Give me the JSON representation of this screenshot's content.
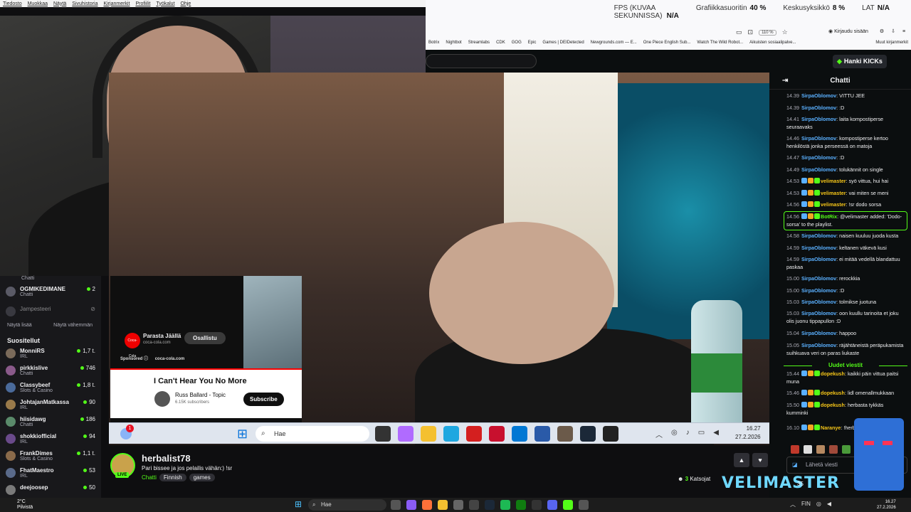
{
  "menubar": [
    "Tiedosto",
    "Muokkaa",
    "Näytä",
    "Sivuhistoria",
    "Kirjanmerkit",
    "Profiilit",
    "Työkalut",
    "Ohje"
  ],
  "perf": {
    "fps_label": "FPS (KUVAA SEKUNNISSA)",
    "fps_value": "N/A",
    "gpu_label": "Grafiikkasuoritin",
    "gpu_value": "40 %",
    "ram_label": "Keskusyksikkö",
    "ram_value": "8 %",
    "lat_label": "LAT",
    "lat_value": "N/A"
  },
  "browser": {
    "zoom": "110 %",
    "login": "Kirjaudu sisään",
    "other_bookmarks": "Muut kirjanmerkit"
  },
  "bookmarks": [
    "Botrix",
    "Nightbot",
    "Streamlabs",
    "CDK",
    "GOG",
    "Epic",
    "Games | DEIDetected",
    "Newgrounds.com — E...",
    "One Piece English Sub...",
    "Watch The Wild Robot...",
    "Aikuisten sosiaalipalve..."
  ],
  "kick": {
    "get_kicks": "Hanki KICKs"
  },
  "sidebar": {
    "top_items": [
      {
        "name": "OGMIKEDIMANE",
        "category": "Chatti",
        "viewers": "2"
      },
      {
        "name": "Jampesteeri",
        "category": "",
        "viewers": ""
      }
    ],
    "show_more": "Näytä lisää",
    "show_less": "Näytä vähemmän",
    "recommended_header": "Suositellut",
    "recommended": [
      {
        "name": "MonniRS",
        "category": "IRL",
        "viewers": "1,7 t."
      },
      {
        "name": "pirkkislive",
        "category": "Chatti",
        "viewers": "746"
      },
      {
        "name": "Classybeef",
        "category": "Slots & Casino",
        "viewers": "1,8 t."
      },
      {
        "name": "JohtajanMatkassa",
        "category": "IRL",
        "viewers": "90"
      },
      {
        "name": "hiisidawg",
        "category": "Chatti",
        "viewers": "186"
      },
      {
        "name": "shokkiofficial",
        "category": "IRL",
        "viewers": "94"
      },
      {
        "name": "FrankDimes",
        "category": "Slots & Casino",
        "viewers": "1,1 t."
      },
      {
        "name": "FhatMaestro",
        "category": "IRL",
        "viewers": "53"
      },
      {
        "name": "deejoosep",
        "category": "",
        "viewers": "50"
      }
    ],
    "first_cat": "Chatti"
  },
  "youtube": {
    "ad_name": "Parasta Jäällä",
    "ad_domain": "coca-cola.com",
    "ad_logo": "Coca-Cola",
    "visit_button": "Osallistu",
    "sponsored": "Sponsored",
    "sponsored_domain": "coca-cola.com",
    "title": "I Can't Hear You No More",
    "channel": "Russ Ballard - Topic",
    "subs": "6.15K subscribers",
    "subscribe": "Subscribe"
  },
  "stream_taskbar": {
    "badge": "1",
    "search": "Hae",
    "time": "16.27",
    "date": "27.2.2026"
  },
  "channel": {
    "name": "herbalist78",
    "live": "LIVE",
    "title": "Pari bissee ja jos pelailis vähän:) !sr",
    "category": "Chatti",
    "tags": [
      "Finnish",
      "games"
    ],
    "viewers_count": "3",
    "viewers_label": "Katsojat"
  },
  "chat": {
    "title": "Chatti",
    "messages": [
      {
        "t": "14.39",
        "u": "SirpaOblomov",
        "c": "#5ab0ff",
        "m": "VITTU JEE"
      },
      {
        "t": "14.39",
        "u": "SirpaOblomov",
        "c": "#5ab0ff",
        "m": ":D"
      },
      {
        "t": "14.41",
        "u": "SirpaOblomov",
        "c": "#5ab0ff",
        "m": "laita kompostiperse seuraavaks"
      },
      {
        "t": "14.46",
        "u": "SirpaOblomov",
        "c": "#5ab0ff",
        "m": "kompostiperse kertoo henkilöstä jonka perseessä on matoja"
      },
      {
        "t": "14.47",
        "u": "SirpaOblomov",
        "c": "#5ab0ff",
        "m": ":D"
      },
      {
        "t": "14.49",
        "u": "SirpaOblomov",
        "c": "#5ab0ff",
        "m": "tolukännit on single"
      },
      {
        "t": "14.53",
        "u": "velimaster",
        "c": "#f5c518",
        "m": "syö vittua, hui hai"
      },
      {
        "t": "14.53",
        "u": "velimaster",
        "c": "#f5c518",
        "m": "vai miten se meni"
      },
      {
        "t": "14.56",
        "u": "velimaster",
        "c": "#f5c518",
        "m": "!sr dodo sorsa"
      },
      {
        "t": "14.56",
        "u": "BotRix",
        "c": "#53fc18",
        "m": "@velimaster added: 'Dodo-sorsa' to the playlist."
      },
      {
        "t": "14.58",
        "u": "SirpaOblomov",
        "c": "#5ab0ff",
        "m": "naisen kuuluu juoda kusta"
      },
      {
        "t": "14.59",
        "u": "SirpaOblomov",
        "c": "#5ab0ff",
        "m": "keltanen väkevä kusi"
      },
      {
        "t": "14.59",
        "u": "SirpaOblomov",
        "c": "#5ab0ff",
        "m": "ei mitää vedellä blandattuu paskaa"
      },
      {
        "t": "15.00",
        "u": "SirpaOblomov",
        "c": "#5ab0ff",
        "m": "rerockkia"
      },
      {
        "t": "15.00",
        "u": "SirpaOblomov",
        "c": "#5ab0ff",
        "m": ":D"
      },
      {
        "t": "15.03",
        "u": "SirpaOblomov",
        "c": "#5ab0ff",
        "m": "tolmikse juotuna"
      },
      {
        "t": "15.03",
        "u": "SirpaOblomov",
        "c": "#5ab0ff",
        "m": "oon kuullu tarinoita et joku olis juonu tippapullon :D"
      },
      {
        "t": "15.04",
        "u": "SirpaOblomov",
        "c": "#5ab0ff",
        "m": "happoo"
      },
      {
        "t": "15.05",
        "u": "SirpaOblomov",
        "c": "#5ab0ff",
        "m": "räjähtäneistä peräpukamista suihkuava veri on paras liukaste"
      },
      {
        "t": "15.44",
        "u": "dopekush",
        "c": "#f5c518",
        "m": "kaikki päin vittua paitsi muna"
      },
      {
        "t": "15.46",
        "u": "dopekush",
        "c": "#f5c518",
        "m": "lidl omenallmukkaan"
      },
      {
        "t": "15.50",
        "u": "dopekush",
        "c": "#f5c518",
        "m": "herbasta tykkäs kumminki"
      },
      {
        "t": "16.10",
        "u": "Naranye",
        "c": "#f5c518",
        "m": "!herba herba herba"
      }
    ],
    "new_messages": "Uudet viestit",
    "input_placeholder": "Lähetä viesti",
    "count": "35"
  },
  "overlay": {
    "brand": "VELIMASTER"
  },
  "taskbar": {
    "weather_temp": "2°C",
    "weather_desc": "Pilvistä",
    "search": "Hae",
    "time": "16.27",
    "date": "27.2.2026",
    "lang": "FIN"
  }
}
